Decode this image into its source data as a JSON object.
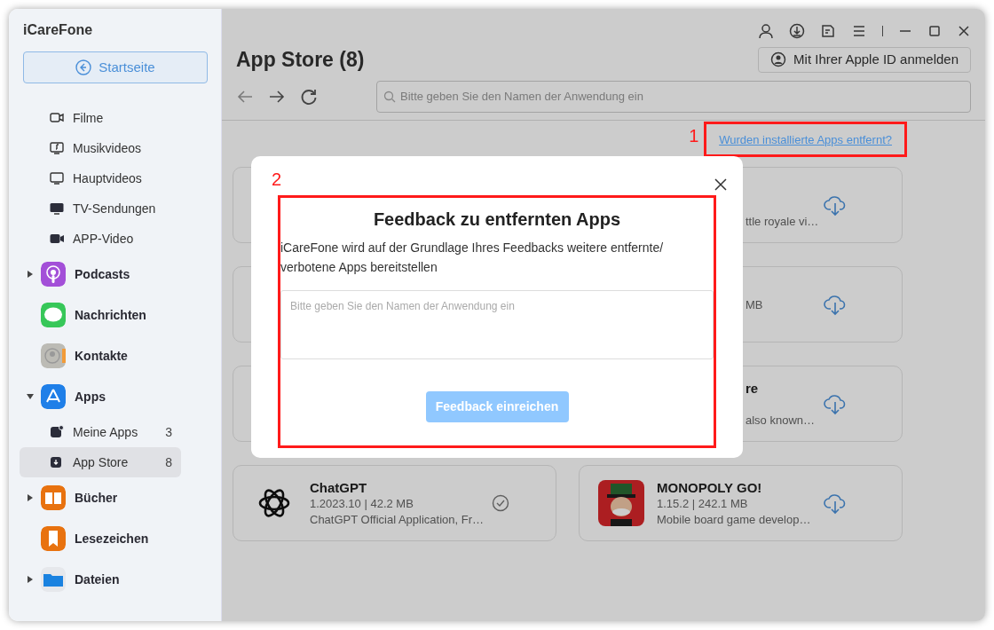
{
  "app": {
    "name": "iCareFone",
    "home_button": "Startseite"
  },
  "sidebar": {
    "items": [
      {
        "kind": "sub",
        "label": "Filme",
        "selected": false
      },
      {
        "kind": "sub",
        "label": "Musikvideos",
        "selected": false
      },
      {
        "kind": "sub",
        "label": "Hauptvideos",
        "selected": false
      },
      {
        "kind": "sub",
        "label": "TV-Sendungen",
        "selected": false
      },
      {
        "kind": "sub",
        "label": "APP-Video",
        "selected": false
      },
      {
        "kind": "group",
        "label": "Podcasts",
        "expanded": false
      },
      {
        "kind": "group",
        "label": "Nachrichten"
      },
      {
        "kind": "group",
        "label": "Kontakte"
      },
      {
        "kind": "group",
        "label": "Apps",
        "expanded": true,
        "children": [
          {
            "kind": "sub",
            "label": "Meine Apps",
            "count": "3",
            "selected": false
          },
          {
            "kind": "sub",
            "label": "App Store",
            "count": "8",
            "selected": true
          }
        ]
      },
      {
        "kind": "group",
        "label": "Bücher",
        "expanded": false
      },
      {
        "kind": "group",
        "label": "Lesezeichen"
      },
      {
        "kind": "group",
        "label": "Dateien",
        "expanded": false
      }
    ]
  },
  "header": {
    "title": "App Store (8)",
    "apple_id_button": "Mit Ihrer Apple ID anmelden",
    "search": {
      "placeholder": "Bitte geben Sie den Namen der Anwendung ein"
    },
    "removed_apps_link": "Wurden installierte Apps entfernt?"
  },
  "apps": [
    {
      "kind": "covered"
    },
    {
      "kind": "covered",
      "desc": "ttle royale vi…",
      "installed": false
    },
    {
      "kind": "covered"
    },
    {
      "kind": "covered",
      "meta": "MB",
      "installed": false
    },
    {
      "kind": "covered"
    },
    {
      "kind": "covered",
      "title": "re",
      "desc": "also known…",
      "installed": false
    },
    {
      "kind": "full",
      "title": "ChatGPT",
      "meta": "1.2023.10 | 42.2 MB",
      "desc": "ChatGPT Official Application, Fr…",
      "installed": true
    },
    {
      "kind": "full",
      "title": "MONOPOLY GO!",
      "meta": "1.15.2 | 242.1 MB",
      "desc": "Mobile board game develop…",
      "installed": false
    }
  ],
  "modal": {
    "title": "Feedback zu entfernten Apps",
    "text": "iCareFone wird auf der Grundlage Ihres Feedbacks weitere entfernte/ verbotene Apps bereitstellen",
    "field": {
      "placeholder": "Bitte geben Sie den Namen der Anwendung ein"
    },
    "submit": {
      "label": "Feedback einreichen",
      "disabled": true
    }
  },
  "annotations": [
    {
      "label": "1"
    },
    {
      "label": "2"
    }
  ]
}
